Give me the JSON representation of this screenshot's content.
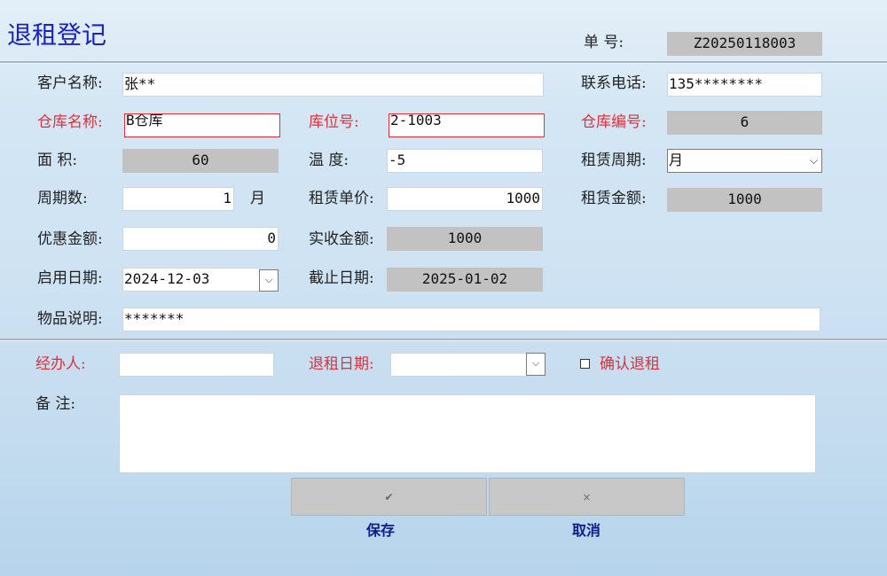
{
  "title": "退租登记",
  "order": {
    "label": "单    号:",
    "value": "Z20250118003"
  },
  "customer": {
    "label": "客户名称:",
    "value": "张**"
  },
  "phone": {
    "label": "联系电话:",
    "value": "135********"
  },
  "warehouse_name": {
    "label": "仓库名称:",
    "value": "B仓库"
  },
  "location_no": {
    "label": "库位号:",
    "value": "2-1003"
  },
  "warehouse_no": {
    "label": "仓库编号:",
    "value": "6"
  },
  "area": {
    "label": "面    积:",
    "value": "60"
  },
  "temperature": {
    "label": "温    度:",
    "value": "-5"
  },
  "lease_period": {
    "label": "租赁周期:",
    "value": "月"
  },
  "period_count": {
    "label": "周期数:",
    "value": "1",
    "unit": "月"
  },
  "unit_price": {
    "label": "租赁单价:",
    "value": "1000"
  },
  "lease_amount": {
    "label": "租赁金额:",
    "value": "1000"
  },
  "discount": {
    "label": "优惠金额:",
    "value": "0"
  },
  "actual_amount": {
    "label": "实收金额:",
    "value": "1000"
  },
  "start_date": {
    "label": "启用日期:",
    "value": "2024-12-03"
  },
  "end_date": {
    "label": "截止日期:",
    "value": "2025-01-02"
  },
  "item_desc": {
    "label": "物品说明:",
    "value": "*******"
  },
  "handler": {
    "label": "经办人:",
    "value": ""
  },
  "return_date": {
    "label": "退租日期:",
    "value": ""
  },
  "confirm": {
    "label": "确认退租"
  },
  "remark": {
    "label": "备    注:",
    "value": ""
  },
  "buttons": {
    "save": {
      "label": "保存",
      "icon": "✔"
    },
    "cancel": {
      "label": "取消",
      "icon": "×"
    }
  },
  "colors": {
    "title": "#1b22c6",
    "required_label": "#e0303a",
    "button_label": "#0b1c8c",
    "readonly_bg": "#c2c2c2"
  }
}
